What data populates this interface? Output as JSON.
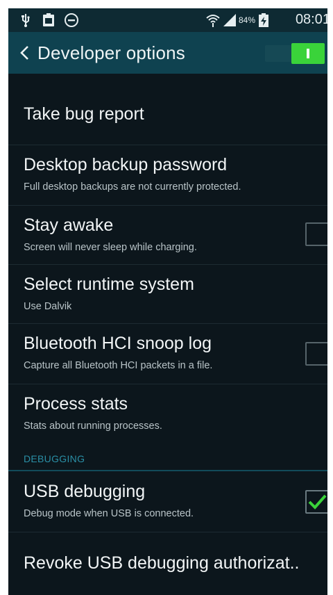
{
  "status_bar": {
    "battery_percent": "84%",
    "time": "08:01"
  },
  "action_bar": {
    "title": "Developer options",
    "master_switch": "on"
  },
  "settings": [
    {
      "title": "Take bug report",
      "subtitle": ""
    },
    {
      "title": "Desktop backup password",
      "subtitle": "Full desktop backups are not currently protected."
    },
    {
      "title": "Stay awake",
      "subtitle": "Screen will never sleep while charging.",
      "checked": false
    },
    {
      "title": "Select runtime system",
      "subtitle": "Use Dalvik"
    },
    {
      "title": "Bluetooth HCI snoop log",
      "subtitle": "Capture all Bluetooth HCI packets in a file.",
      "checked": false
    },
    {
      "title": "Process stats",
      "subtitle": "Stats about running processes."
    }
  ],
  "debugging": {
    "header": "DEBUGGING",
    "items": [
      {
        "title": "USB debugging",
        "subtitle": "Debug mode when USB is connected.",
        "checked": true
      },
      {
        "title": "Revoke USB debugging authorizat..",
        "subtitle": ""
      }
    ]
  },
  "colors": {
    "accent_green": "#3ad33a",
    "action_bar": "#0f4250",
    "section_header": "#2a8fa6"
  }
}
